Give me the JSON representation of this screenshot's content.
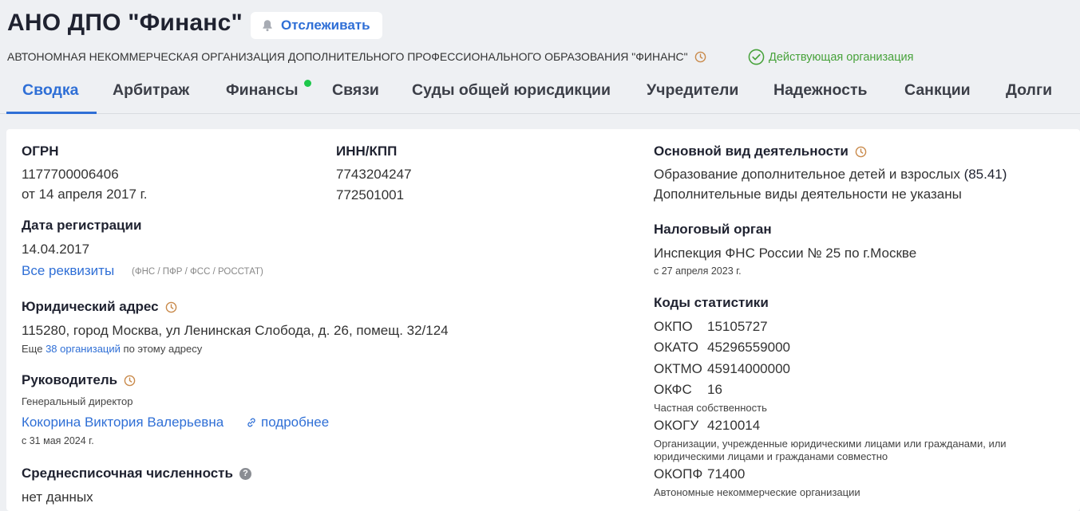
{
  "header": {
    "title": "АНО ДПО \"Финанс\"",
    "follow_label": "Отслеживать",
    "full_name": "АВТОНОМНАЯ НЕКОММЕРЧЕСКАЯ ОРГАНИЗАЦИЯ ДОПОЛНИТЕЛЬНОГО ПРОФЕССИОНАЛЬНОГО ОБРАЗОВАНИЯ \"ФИНАНС\"",
    "status": "Действующая организация"
  },
  "tabs": [
    "Сводка",
    "Арбитраж",
    "Финансы",
    "Связи",
    "Суды общей юрисдикции",
    "Учредители",
    "Надежность",
    "Санкции",
    "Долги"
  ],
  "ogrn": {
    "label": "ОГРН",
    "value": "1177700006406",
    "date": "от 14 апреля 2017 г."
  },
  "inn": {
    "label": "ИНН/КПП",
    "inn": "7743204247",
    "kpp": "772501001"
  },
  "registration": {
    "label": "Дата регистрации",
    "value": "14.04.2017",
    "all_link": "Все реквизиты",
    "sources": "(ФНС / ПФР / ФСС / РОССТАТ)"
  },
  "address": {
    "label": "Юридический адрес",
    "value": "115280, город Москва, ул Ленинская Слобода, д. 26, помещ. 32/124",
    "more_prefix": "Еще",
    "more_link": "38 организаций",
    "more_suffix": "по этому адресу"
  },
  "director": {
    "label": "Руководитель",
    "position": "Генеральный директор",
    "name": "Кокорина Виктория Валерьевна",
    "details": "подробнее",
    "since": "с 31 мая 2024 г."
  },
  "headcount": {
    "label": "Среднесписочная численность",
    "value": "нет данных"
  },
  "activity": {
    "label": "Основной вид деятельности",
    "value": "Образование дополнительное детей и взрослых",
    "code": "(85.41)",
    "extra": "Дополнительные виды деятельности не указаны"
  },
  "tax": {
    "label": "Налоговый орган",
    "value": "Инспекция ФНС России № 25 по г.Москве",
    "since": "с 27 апреля 2023 г."
  },
  "stats": {
    "label": "Коды статистики",
    "okpo_code": "ОКПО",
    "okpo": "15105727",
    "okato_code": "ОКАТО",
    "okato": "45296559000",
    "oktmo_code": "ОКТМО",
    "oktmo": "45914000000",
    "okfs_code": "ОКФС",
    "okfs": "16",
    "okfs_note": "Частная собственность",
    "okogu_code": "ОКОГУ",
    "okogu": "4210014",
    "okogu_note1": "Организации, учрежденные юридическими лицами или гражданами, или",
    "okogu_note2": "юридическими лицами и гражданами совместно",
    "okopf_code": "ОКОПФ",
    "okopf": "71400",
    "okopf_note": "Автономные некоммерческие организации"
  },
  "colors": {
    "accent": "#2f6fd6",
    "status": "#47a23a",
    "clock": "#c98a4b",
    "dot": "#1ec84b"
  }
}
